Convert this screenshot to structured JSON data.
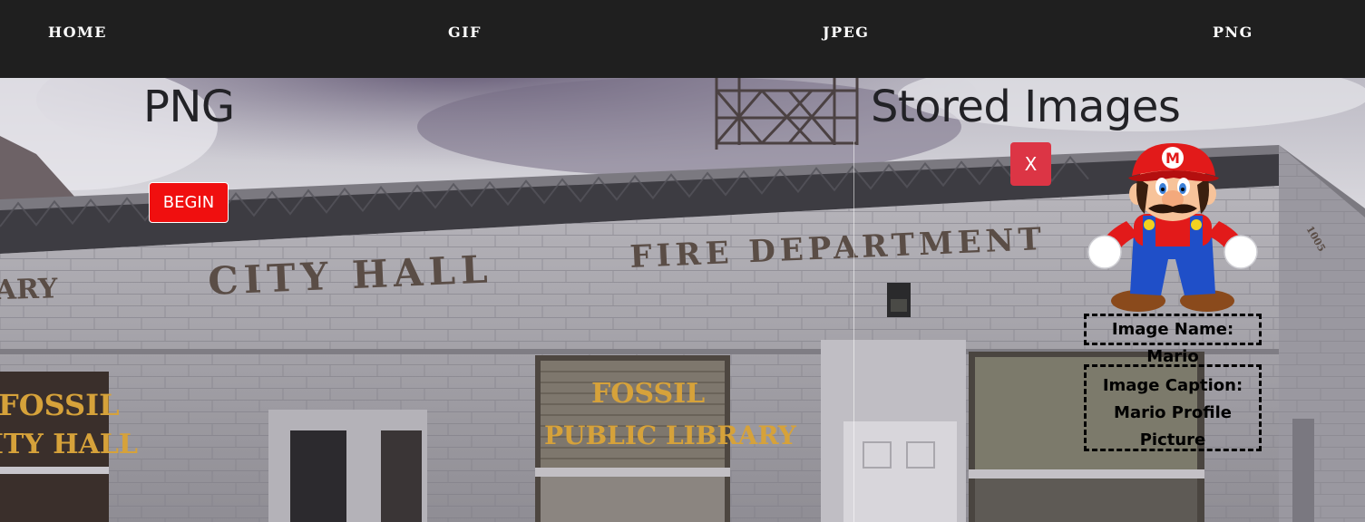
{
  "nav": {
    "items": [
      "HOME",
      "GIF",
      "JPEG",
      "PNG"
    ]
  },
  "page": {
    "title": "PNG",
    "begin_label": "BEGIN"
  },
  "stored": {
    "title": "Stored Images",
    "close_label": "X",
    "image": {
      "name_text": "Image Name: Mario",
      "caption_text": "Image Caption: Mario Profile Picture"
    }
  },
  "background": {
    "signs": {
      "library": "ARY",
      "city_hall": "CITY  HALL",
      "fire_department": "FIRE  DEPARTMENT",
      "fossil_left_1": "FOSSIL",
      "fossil_left_2": "ITY HALL",
      "fossil_center_1": "FOSSIL",
      "fossil_center_2": "PUBLIC LIBRARY",
      "address": "1005"
    }
  },
  "colors": {
    "navbar": "#1f1f1f",
    "begin_button": "#f00f0f",
    "close_button": "#dc3545",
    "sign_gold": "#d6a23a",
    "wall": "#a8a6ad"
  }
}
